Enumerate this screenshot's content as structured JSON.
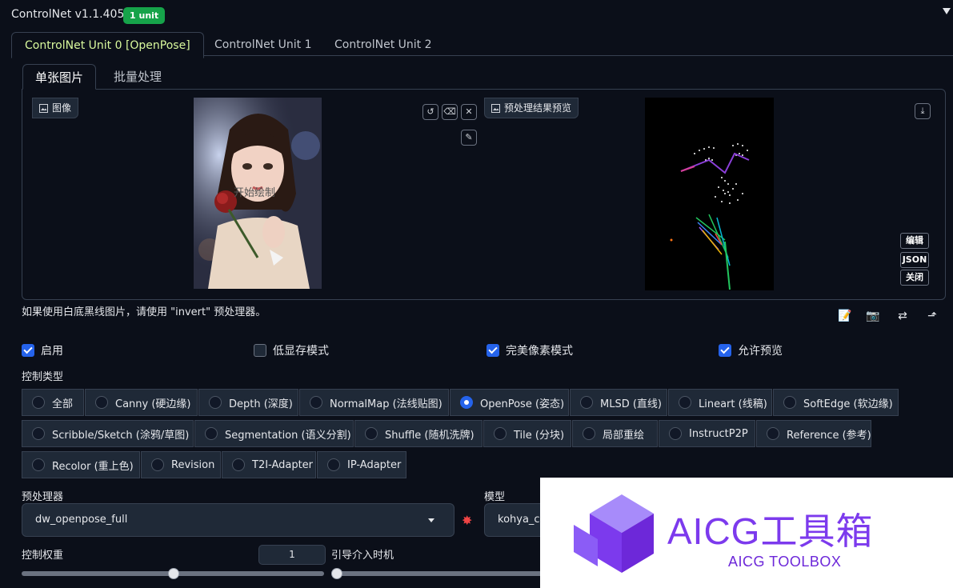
{
  "header": {
    "title": "ControlNet v1.1.405",
    "badge": "1 unit"
  },
  "unit_tabs": [
    {
      "label": "ControlNet Unit 0 [OpenPose]",
      "active": true
    },
    {
      "label": "ControlNet Unit 1",
      "active": false
    },
    {
      "label": "ControlNet Unit 2",
      "active": false
    }
  ],
  "sub_tabs": [
    {
      "label": "单张图片",
      "active": true
    },
    {
      "label": "批量处理",
      "active": false
    }
  ],
  "image_panel": {
    "input_label": "图像",
    "overlay_text": "开始绘制",
    "preview_label": "预处理结果预览",
    "edit_label": "编辑",
    "json_label": "JSON",
    "close_label": "关闭"
  },
  "hint": "如果使用白底黑线图片，请使用 \"invert\" 预处理器。",
  "checkboxes": [
    {
      "label": "启用",
      "checked": true
    },
    {
      "label": "低显存模式",
      "checked": false
    },
    {
      "label": "完美像素模式",
      "checked": true
    },
    {
      "label": "允许预览",
      "checked": true
    }
  ],
  "control_type": {
    "label": "控制类型",
    "options": [
      "全部",
      "Canny (硬边缘)",
      "Depth (深度)",
      "NormalMap (法线贴图)",
      "OpenPose (姿态)",
      "MLSD (直线)",
      "Lineart (线稿)",
      "SoftEdge (软边缘)",
      "Scribble/Sketch (涂鸦/草图)",
      "Segmentation (语义分割)",
      "Shuffle (随机洗牌)",
      "Tile (分块)",
      "局部重绘",
      "InstructP2P",
      "Reference (参考)",
      "Recolor (重上色)",
      "Revision",
      "T2I-Adapter",
      "IP-Adapter"
    ],
    "selected": "OpenPose (姿态)"
  },
  "preprocessor": {
    "label": "预处理器",
    "value": "dw_openpose_full"
  },
  "model": {
    "label": "模型",
    "value": "kohya_co"
  },
  "control_weight": {
    "label": "控制权重",
    "value": "1",
    "level": 0.5
  },
  "guidance_start": {
    "label": "引导介入时机",
    "level": 0
  },
  "watermark": {
    "title": "AICG工具箱",
    "subtitle": "AICG TOOLBOX"
  },
  "colors": {
    "accent": "#2563eb",
    "badge": "#16a34a",
    "active_tab": "#d9f99d",
    "watermark": "#7c3aed"
  }
}
